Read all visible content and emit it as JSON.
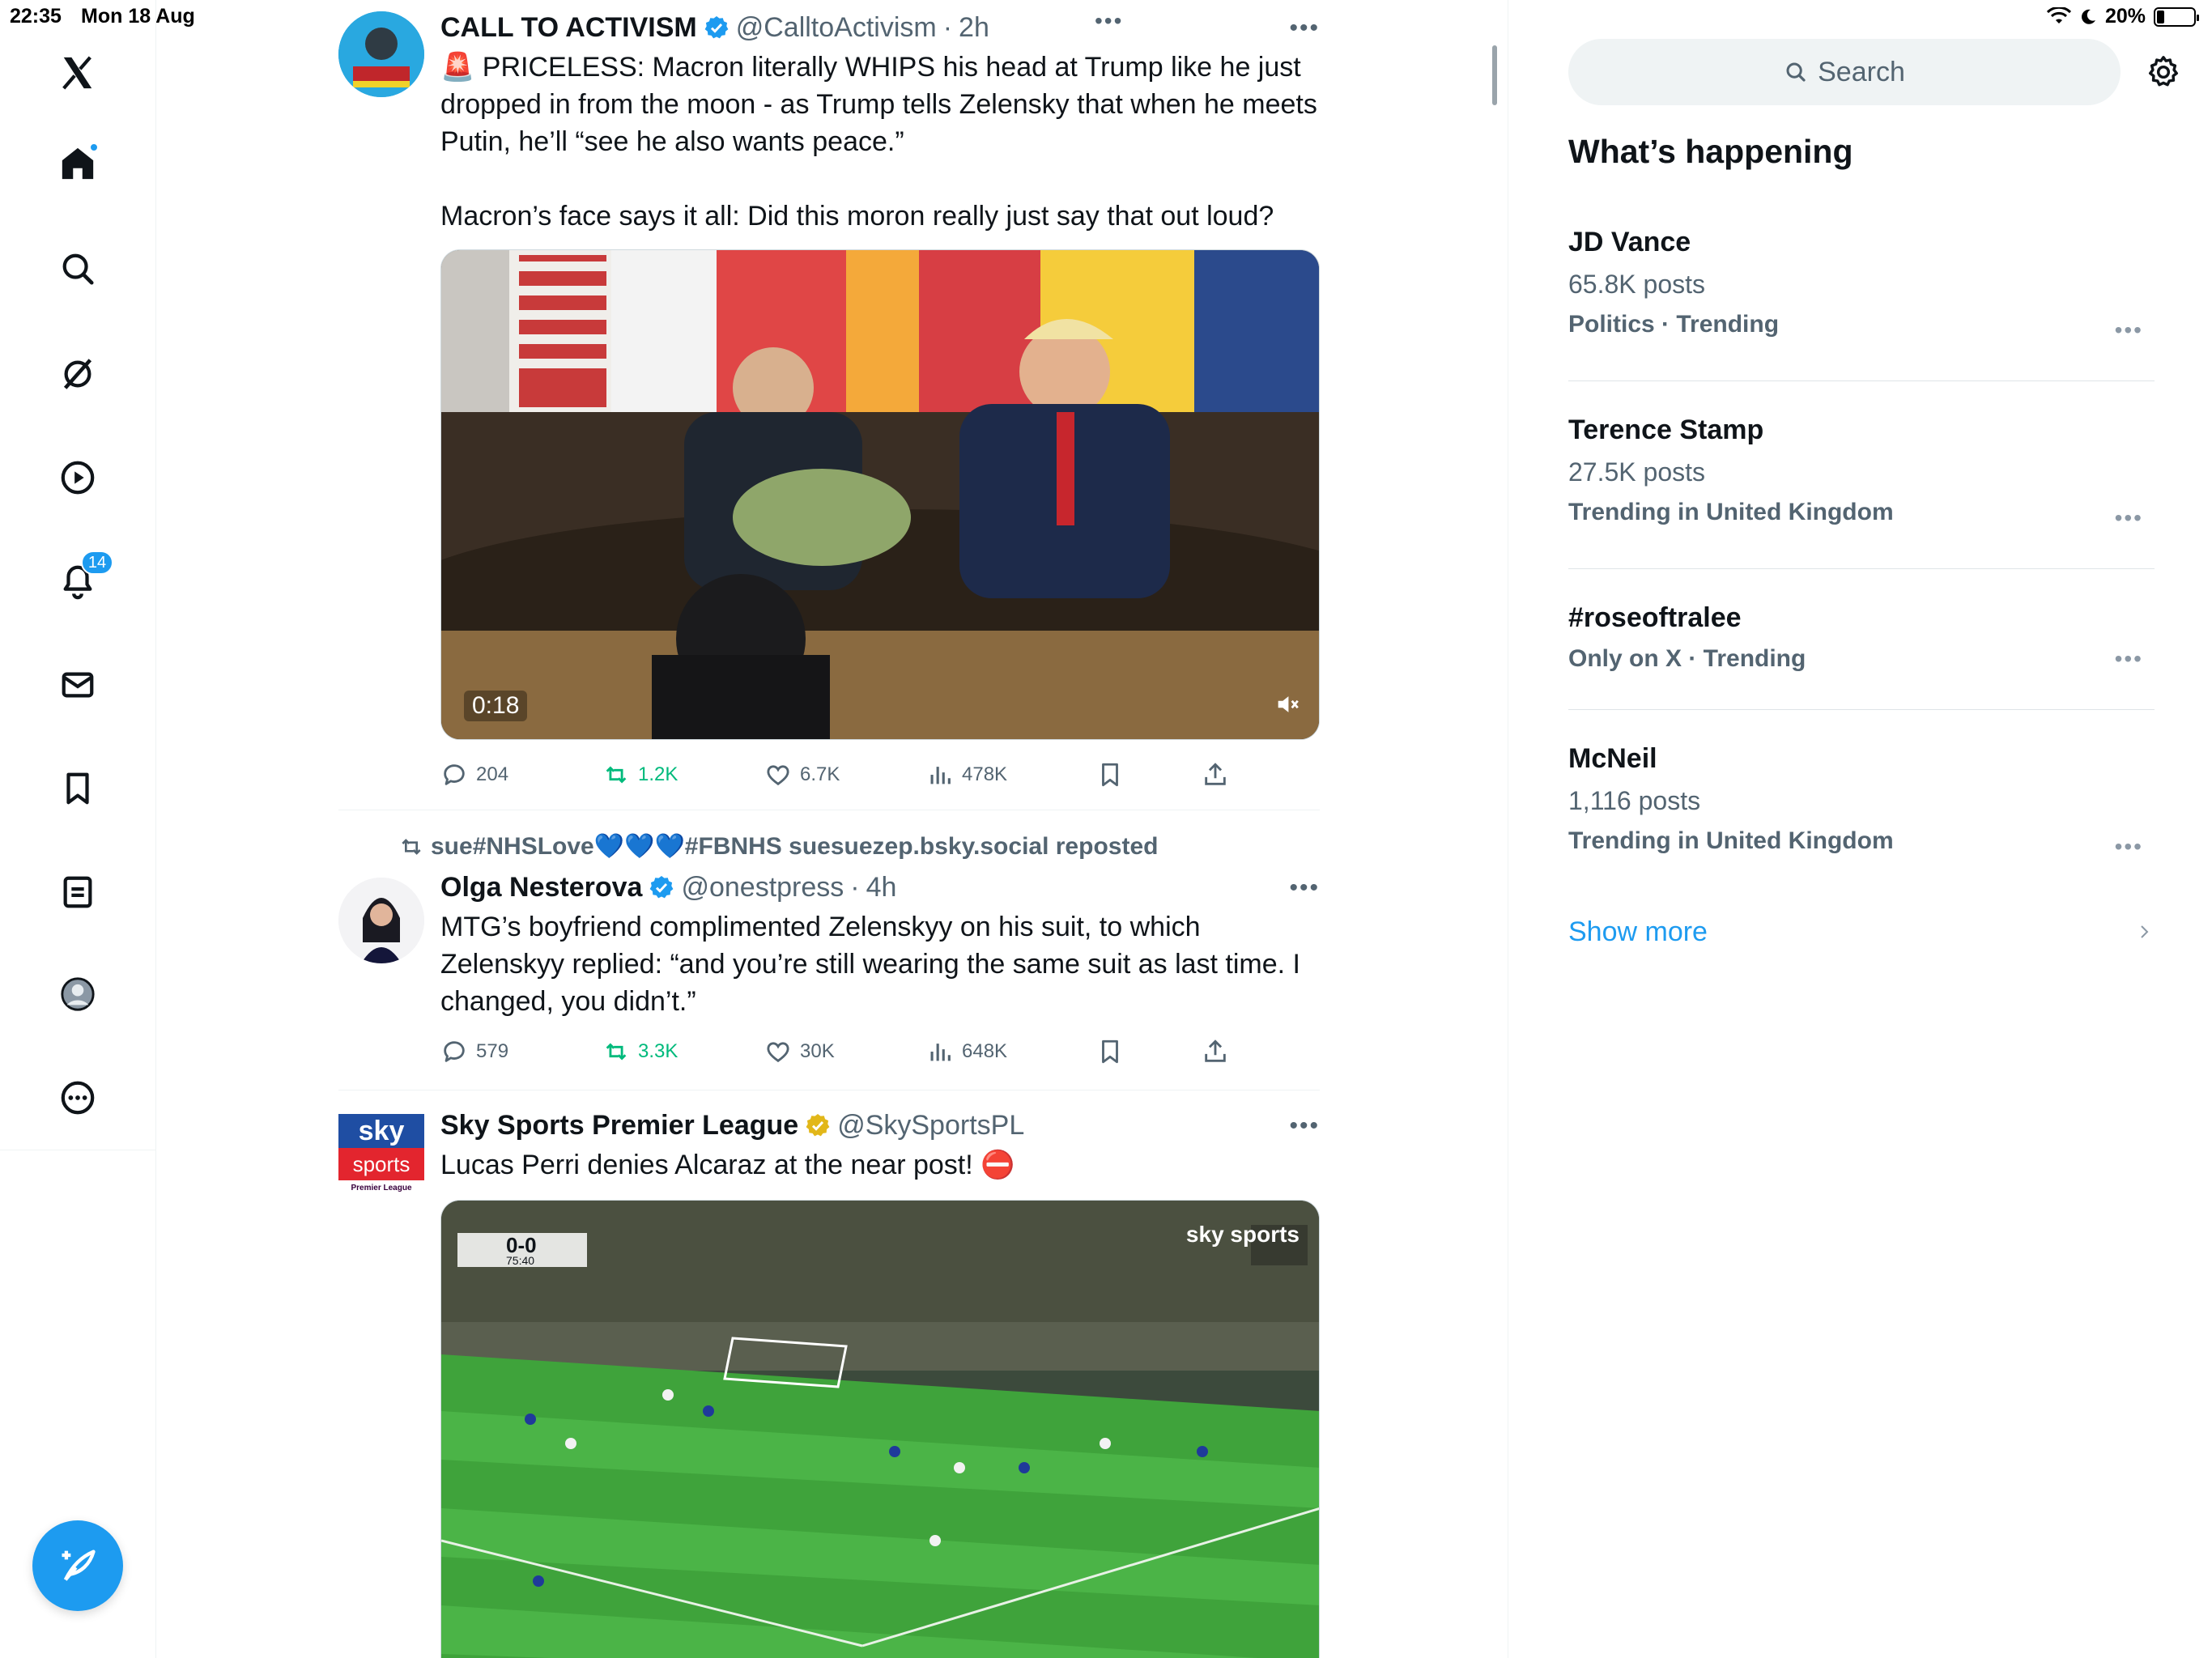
{
  "status_bar": {
    "time": "22:35",
    "date": "Mon 18 Aug",
    "battery": "20%",
    "battery_level": 0.2
  },
  "nav": {
    "notifications_badge": "14"
  },
  "tweets": [
    {
      "name": "CALL TO ACTIVISM",
      "handle": "@CalltoActivism",
      "time": "2h",
      "top_dots": "•••",
      "more": "•••",
      "text": "🚨 PRICELESS: Macron literally WHIPS his head at Trump like he just dropped in from the moon - as Trump tells Zelensky that when he meets Putin, he’ll “see he also wants peace.”\n\nMacron’s face says it all: Did this moron really just say that out loud?",
      "video_time": "0:18",
      "replies": "204",
      "reposts": "1.2K",
      "likes": "6.7K",
      "views": "478K"
    },
    {
      "repost_by": "sue#NHSLove💙💙💙#FBNHS suesuezep.bsky.social reposted",
      "name": "Olga Nesterova",
      "handle": "@onestpress",
      "time": "4h",
      "more": "•••",
      "text": "MTG’s boyfriend complimented Zelenskyy on his suit, to which Zelenskyy replied: “and you’re still wearing the same suit as last time. I changed, you didn’t.”",
      "replies": "579",
      "reposts": "3.3K",
      "likes": "30K",
      "views": "648K"
    },
    {
      "name": "Sky Sports Premier League",
      "handle": "@SkySportsPL",
      "more": "•••",
      "text": "Lucas Perri denies Alcaraz at the near post! ⛔",
      "avatar_top": "sky",
      "avatar_bottom": "sports",
      "avatar_league": "Premier League",
      "score": "0-0",
      "match_clock": "75:40",
      "watermark": "sky sports"
    }
  ],
  "sidebar": {
    "search_placeholder": "Search",
    "whats_happening": "What’s happening",
    "trends": [
      {
        "name": "JD Vance",
        "posts": "65.8K posts",
        "category": "Politics · Trending",
        "more": "•••"
      },
      {
        "name": "Terence Stamp",
        "posts": "27.5K posts",
        "category": "Trending in United Kingdom",
        "more": "•••"
      },
      {
        "name": "#roseoftralee",
        "category": "Only on X · Trending",
        "more": "•••"
      },
      {
        "name": "McNeil",
        "posts": "1,116 posts",
        "category": "Trending in United Kingdom",
        "more": "•••"
      }
    ],
    "show_more": "Show more"
  },
  "colors": {
    "accent": "#1d9bf0",
    "repost": "#00ba7c",
    "text": "#0f1419",
    "secondary": "#536471",
    "gold_check": "#e2b719"
  }
}
